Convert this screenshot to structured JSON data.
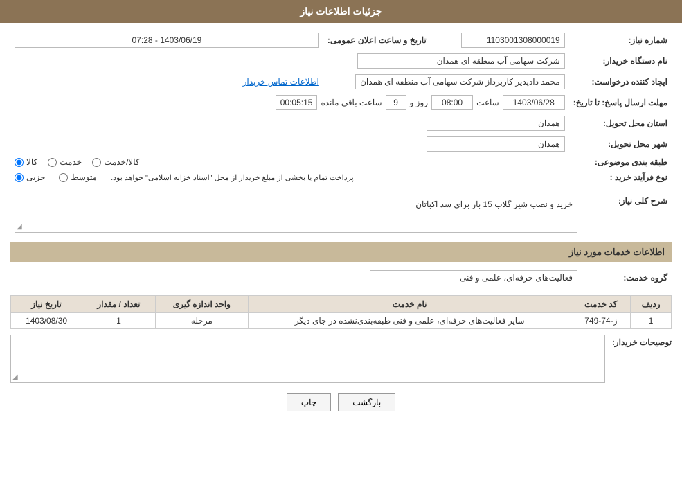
{
  "header": {
    "title": "جزئیات اطلاعات نیاز"
  },
  "fields": {
    "need_number_label": "شماره نیاز:",
    "need_number_value": "1103001308000019",
    "buyer_org_label": "نام دستگاه خریدار:",
    "buyer_org_value": "شرکت سهامی آب منطقه ای همدان",
    "creator_label": "ایجاد کننده درخواست:",
    "creator_value": "محمد دادپذیر کاربرداز شرکت سهامی آب منطقه ای همدان",
    "creator_link": "اطلاعات تماس خریدار",
    "announce_date_label": "تاریخ و ساعت اعلان عمومی:",
    "announce_date_value": "1403/06/19 - 07:28",
    "response_deadline_label": "مهلت ارسال پاسخ: تا تاریخ:",
    "response_date": "1403/06/28",
    "response_time_label": "ساعت",
    "response_time_value": "08:00",
    "response_day_label": "روز و",
    "response_day_value": "9",
    "remaining_label": "ساعت باقی مانده",
    "remaining_value": "00:05:15",
    "province_label": "استان محل تحویل:",
    "province_value": "همدان",
    "city_label": "شهر محل تحویل:",
    "city_value": "همدان",
    "category_label": "طبقه بندی موضوعی:",
    "cat_options": [
      {
        "label": "کالا",
        "value": "kala"
      },
      {
        "label": "خدمت",
        "value": "khedmat"
      },
      {
        "label": "کالا/خدمت",
        "value": "kala_khedmat"
      }
    ],
    "cat_selected": "kala",
    "purchase_type_label": "نوع فرآیند خرید :",
    "purchase_options": [
      {
        "label": "جزیی",
        "value": "jozee"
      },
      {
        "label": "متوسط",
        "value": "motevaset"
      }
    ],
    "purchase_selected": "jozee",
    "purchase_note": "پرداخت تمام یا بخشی از مبلغ خریدار از محل \"اسناد خزانه اسلامی\" خواهد بود.",
    "need_desc_label": "شرح کلی نیاز:",
    "need_desc_value": "خرید و نصب شیر گلاب 15 بار برای سد اکباتان",
    "services_section_label": "اطلاعات خدمات مورد نیاز",
    "service_group_label": "گروه خدمت:",
    "service_group_value": "فعالیت‌های حرفه‌ای، علمی و فنی",
    "table": {
      "headers": [
        "ردیف",
        "کد خدمت",
        "نام خدمت",
        "واحد اندازه گیری",
        "تعداد / مقدار",
        "تاریخ نیاز"
      ],
      "rows": [
        {
          "row": "1",
          "code": "ز-74-749",
          "name": "سایر فعالیت‌های حرفه‌ای، علمی و فنی طبقه‌بندی‌نشده در جای دیگر",
          "unit": "مرحله",
          "quantity": "1",
          "date": "1403/08/30"
        }
      ]
    },
    "buyer_desc_label": "توصیحات خریدار:"
  },
  "buttons": {
    "print_label": "چاپ",
    "back_label": "بازگشت"
  }
}
